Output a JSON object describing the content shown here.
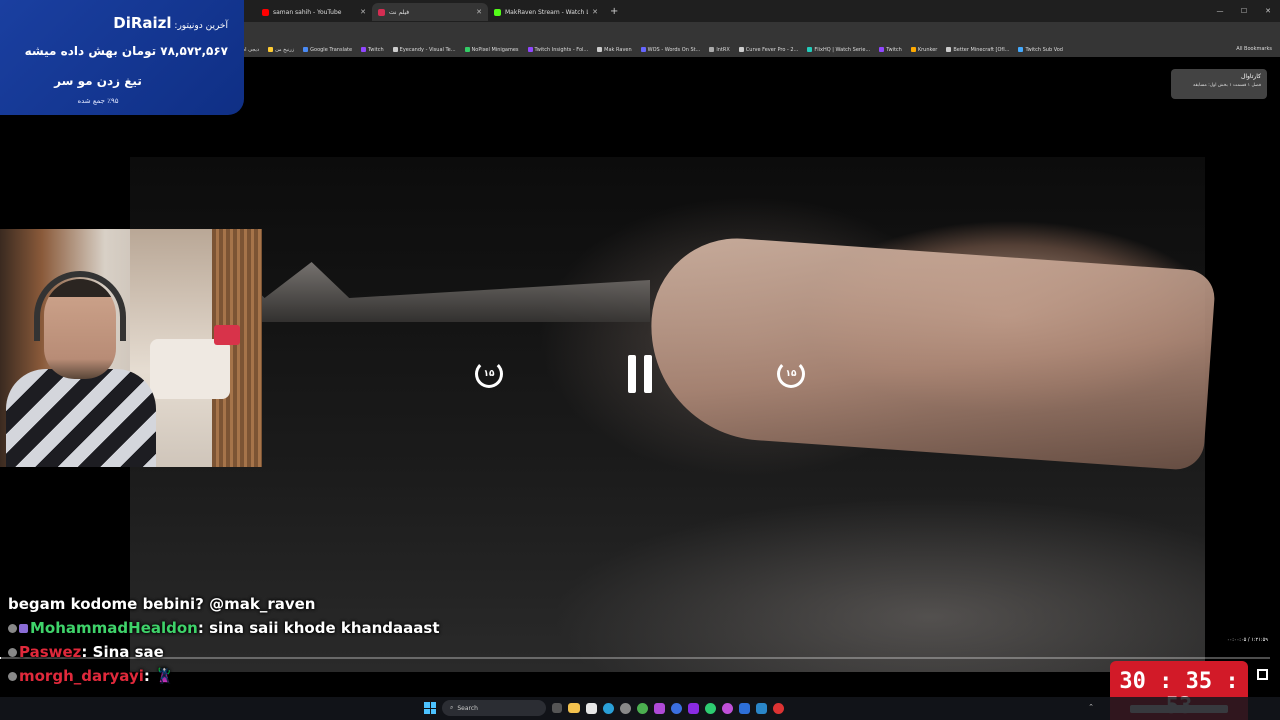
{
  "browser": {
    "tabs": [
      {
        "label": "saman sahih - YouTube",
        "color": "#ff0000",
        "active": false
      },
      {
        "label": "فیلم نت",
        "color": "#d42d52",
        "active": true
      },
      {
        "label": "MakRaven Stream - Watch Live",
        "color": "#53fc18",
        "active": false
      }
    ],
    "new_tab": "+",
    "window_controls": [
      "—",
      "☐",
      "✕"
    ],
    "bookmarks": [
      {
        "label": "دیجی اس",
        "color": "#e33"
      },
      {
        "label": "زرنیخ من",
        "color": "#fc3"
      },
      {
        "label": "Google Translate",
        "color": "#4a8af4"
      },
      {
        "label": "Twitch",
        "color": "#9146ff"
      },
      {
        "label": "Eyecandy - Visual Te...",
        "color": "#ccc"
      },
      {
        "label": "NoPixel Minigames",
        "color": "#3c6"
      },
      {
        "label": "Twitch Insights - Fol...",
        "color": "#9146ff"
      },
      {
        "label": "Mak Raven",
        "color": "#ccc"
      },
      {
        "label": "WOS - Words On St...",
        "color": "#66f"
      },
      {
        "label": "lntRX",
        "color": "#aaa"
      },
      {
        "label": "Curve Fever Pro - 2...",
        "color": "#ccc"
      },
      {
        "label": "FlixHQ | Watch Serie...",
        "color": "#2cb"
      },
      {
        "label": "Twitch",
        "color": "#9146ff"
      },
      {
        "label": "Krunker",
        "color": "#fa0"
      },
      {
        "label": "Better Minecraft [OfI...",
        "color": "#ccc"
      },
      {
        "label": "Twitch Sub Vod",
        "color": "#4af"
      }
    ],
    "all_bookmarks": "All Bookmarks"
  },
  "donor": {
    "label": "آخرین دونیتور:",
    "name": "DiRaizl",
    "amount_line": "۷۸,۵۷۲,۵۶۷ تومان بهش داده میشه",
    "goal_title": "تیغ زدن مو سر",
    "goal_progress": "٪۹۵ جمع شده"
  },
  "player": {
    "skip_back": "۱۵",
    "skip_forward": "۱۵",
    "episode_title": "کارتاوال",
    "episode_sub": "فصل ۱ قسمت ۱ بخش اول: مسابقه",
    "time": "۰۰:۰۰:۰۵ / ۱:۲۱:۵۹",
    "progress": 0.001
  },
  "chat": [
    {
      "user": "",
      "badges": [],
      "text": "begam kodome bebini? @mak_raven",
      "name_color": ""
    },
    {
      "user": "MohammadHealdon",
      "badges": [
        "g",
        "p"
      ],
      "text": "sina saii khode khandaaast",
      "name_color": "green"
    },
    {
      "user": "Paswez",
      "badges": [
        "g"
      ],
      "text": "Sina sae",
      "name_color": "red"
    },
    {
      "user": "morgh_daryayi",
      "badges": [
        "g"
      ],
      "text": "🦹",
      "name_color": "red"
    }
  ],
  "timer": {
    "value": "30 : 35 : 53"
  },
  "taskbar": {
    "search_placeholder": "Search"
  }
}
